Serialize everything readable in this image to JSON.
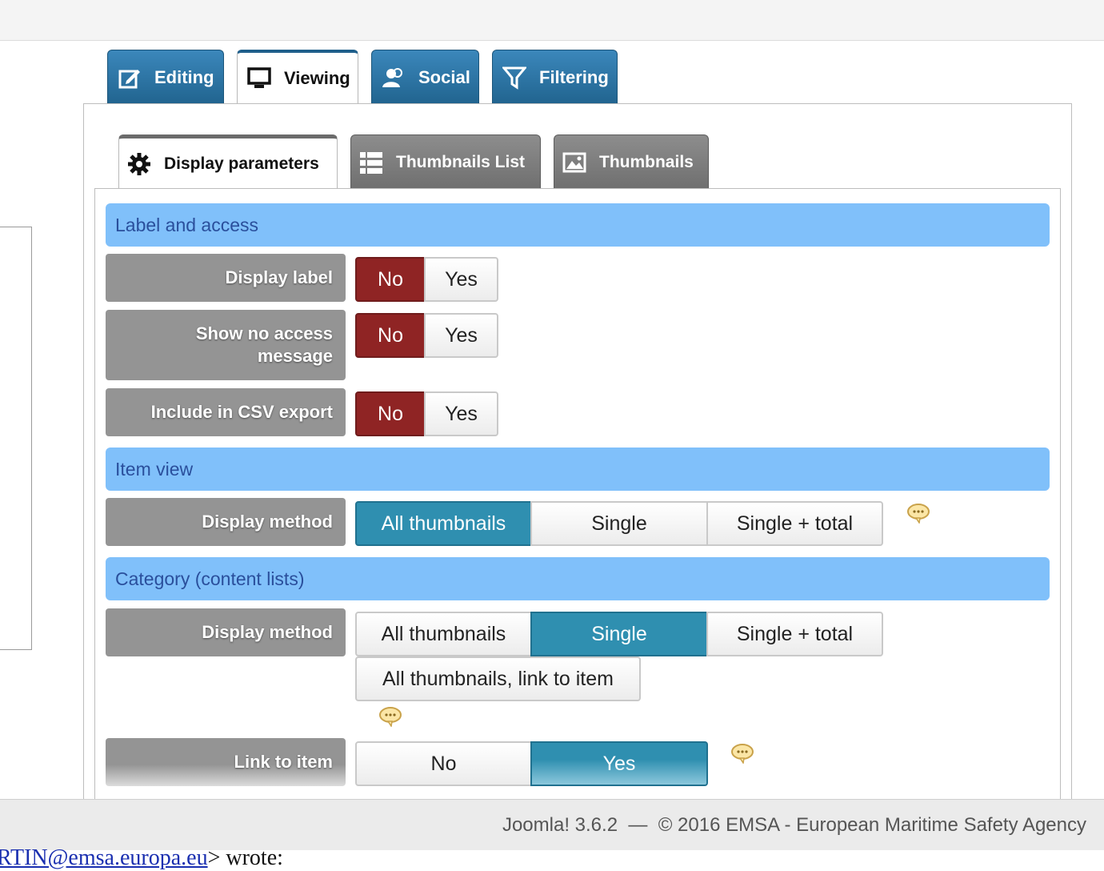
{
  "main_tabs": [
    {
      "label": "Editing",
      "icon": "edit-icon",
      "active": false
    },
    {
      "label": "Viewing",
      "icon": "monitor-icon",
      "active": true
    },
    {
      "label": "Social",
      "icon": "users-icon",
      "active": false
    },
    {
      "label": "Filtering",
      "icon": "filter-icon",
      "active": false
    }
  ],
  "sub_tabs": [
    {
      "label": "Display parameters",
      "icon": "gear-icon",
      "active": true
    },
    {
      "label": "Thumbnails List",
      "icon": "list-icon",
      "active": false
    },
    {
      "label": "Thumbnails",
      "icon": "image-icon",
      "active": false
    }
  ],
  "sections": {
    "label_access": "Label and access",
    "item_view": "Item view",
    "category": "Category (content lists)"
  },
  "fields": {
    "display_label": {
      "label": "Display label",
      "options": [
        "No",
        "Yes"
      ],
      "selected": "No"
    },
    "no_access": {
      "label": "Show no access message",
      "options": [
        "No",
        "Yes"
      ],
      "selected": "No"
    },
    "csv_export": {
      "label": "Include in CSV export",
      "options": [
        "No",
        "Yes"
      ],
      "selected": "No"
    },
    "item_display_method": {
      "label": "Display method",
      "options": [
        "All thumbnails",
        "Single",
        "Single + total"
      ],
      "selected": "All thumbnails"
    },
    "cat_display_method": {
      "label": "Display method",
      "options": [
        "All thumbnails",
        "Single",
        "Single + total",
        "All thumbnails, link to item"
      ],
      "selected": "Single"
    },
    "link_to_item": {
      "label": "Link to item",
      "options": [
        "No",
        "Yes"
      ],
      "selected": "Yes"
    }
  },
  "footer": {
    "text": "Joomla! 3.6.2  —  © 2016 EMSA - European Maritime Safety Agency"
  },
  "background_email": {
    "link": "RTIN@emsa.europa.eu",
    "text": "> wrote:"
  },
  "colors": {
    "tab_blue": "#21648f",
    "section_blue": "#80c0fa",
    "selected_no": "#8f2424",
    "selected_teal": "#2f8fb0",
    "label_gray": "#949494"
  }
}
